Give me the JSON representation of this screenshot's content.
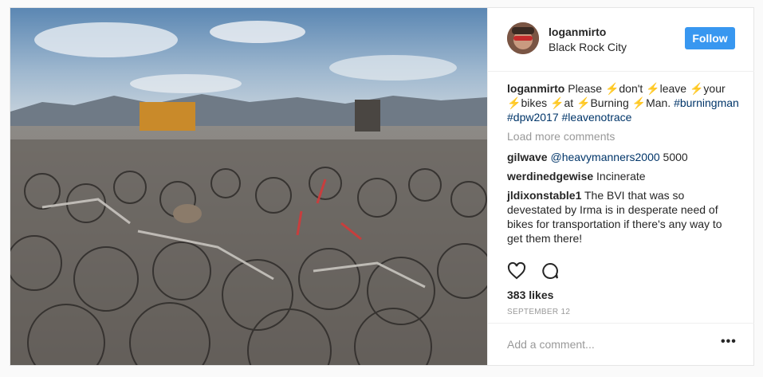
{
  "post": {
    "username": "loganmirto",
    "location": "Black Rock City",
    "follow_label": "Follow"
  },
  "caption": {
    "user": "loganmirto",
    "w1": "Please ",
    "w2": "don't ",
    "w3": "leave ",
    "w4": "your",
    "w5": "bikes ",
    "w6": "at ",
    "w7": "Burning ",
    "w8": "Man. ",
    "tag1": "#burningman",
    "tag2": "#dpw2017",
    "tag3": "#leavenotrace",
    "bolt": "⚡"
  },
  "load_more": "Load more comments",
  "comments": [
    {
      "user": "gilwave",
      "mention": "@heavymanners2000",
      "text": " 5000"
    },
    {
      "user": "werdinedgewise",
      "text": " Incinerate"
    },
    {
      "user": "jldixonstable1",
      "text": " The BVI that was so devestated by Irma is in desperate need of bikes for transportation if there's any way to get them there!"
    }
  ],
  "likes": "383 likes",
  "date": "SEPTEMBER 12",
  "add_comment_placeholder": "Add a comment...",
  "more_label": "•••",
  "icons": {
    "like": "heart-icon",
    "comment": "comment-icon",
    "more": "more-options-icon"
  }
}
